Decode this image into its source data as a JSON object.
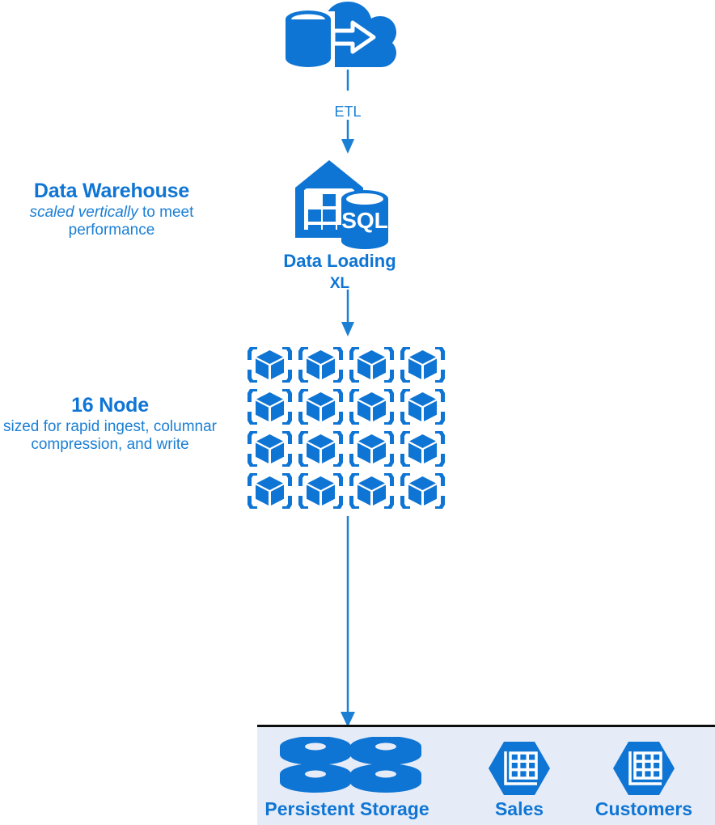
{
  "diagram": {
    "title": "Data Warehouse ETL to Persistent Storage architecture",
    "accent_color": "#0f75d4",
    "line_color": "#1b7fd4",
    "panel_background": "#e6ecf7",
    "panel_border_color": "#0d0d0d"
  },
  "flow": {
    "source": {
      "icon": "cloud-database-migration-icon"
    },
    "etl_arrow": {
      "label": "ETL",
      "icon": "down-arrow-icon"
    },
    "warehouse": {
      "icon": "data-warehouse-sql-icon",
      "caption": "Data Loading",
      "subcaption": "XL"
    },
    "loading_arrow": {
      "icon": "down-arrow-icon"
    },
    "nodes_arrow": {
      "icon": "down-arrow-icon"
    }
  },
  "annotations": {
    "warehouse_note": {
      "title": "Data Warehouse",
      "line1_emphasis": "scaled vertically",
      "line1_rest": " to meet",
      "line2": "performance"
    },
    "nodes_note": {
      "title": "16 Node",
      "line1": "sized for rapid ingest, columnar",
      "line2": "compression, and write"
    }
  },
  "nodes": {
    "count": 16,
    "columns": 4,
    "rows": 4,
    "icon": "compute-node-cube-icon"
  },
  "storage_panel": {
    "items": [
      {
        "label": "Persistent Storage",
        "icon": "disk-stack-icon"
      },
      {
        "label": "Sales",
        "icon": "table-hexagon-icon"
      },
      {
        "label": "Customers",
        "icon": "table-hexagon-icon"
      }
    ]
  }
}
